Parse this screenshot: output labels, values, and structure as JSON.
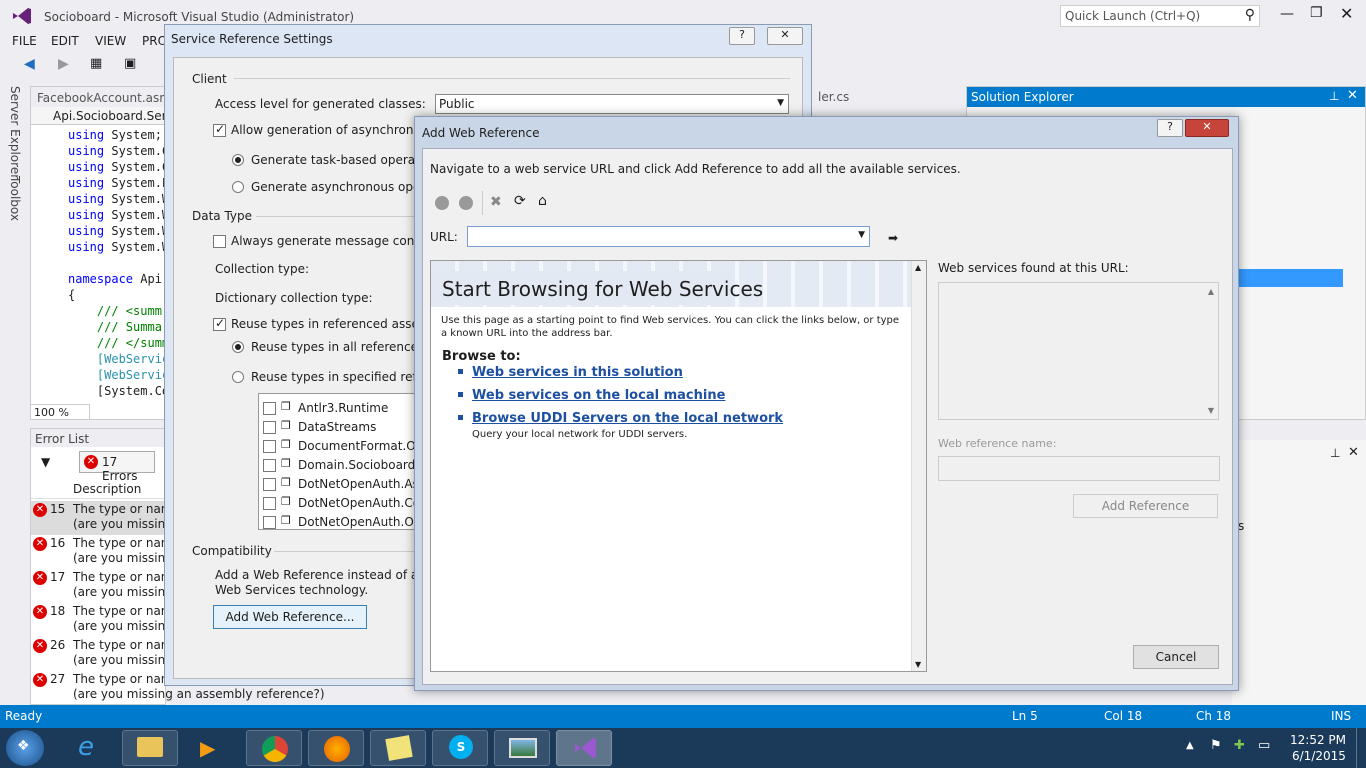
{
  "window": {
    "title": "Socioboard - Microsoft Visual Studio (Administrator)",
    "quick_launch_placeholder": "Quick Launch (Ctrl+Q)"
  },
  "menu": [
    "FILE",
    "EDIT",
    "VIEW",
    "PRO"
  ],
  "side_tabs": [
    "Server Explorer",
    "Toolbox"
  ],
  "editor": {
    "tab": "FacebookAccount.asmx",
    "nav_dropdown": "Api.Socioboard.Servic",
    "zoom": "100 %",
    "lines": [
      {
        "k": "using",
        "t": " System;"
      },
      {
        "k": "using",
        "t": " System.C"
      },
      {
        "k": "using",
        "t": " System.C"
      },
      {
        "k": "using",
        "t": " System.L"
      },
      {
        "k": "using",
        "t": " System.W"
      },
      {
        "k": "using",
        "t": " System.W"
      },
      {
        "k": "using",
        "t": " System.W"
      },
      {
        "k": "using",
        "t": " System.W"
      },
      {
        "k": "",
        "t": ""
      },
      {
        "k": "namespace",
        "t": " Api"
      },
      {
        "k": "",
        "t": "{"
      },
      {
        "k": "",
        "c": "    /// <summ"
      },
      {
        "k": "",
        "c": "    /// Summar"
      },
      {
        "k": "",
        "c": "    /// </summ"
      },
      {
        "k": "",
        "ty": "    [WebServic"
      },
      {
        "k": "",
        "ty": "    [WebServic"
      },
      {
        "k": "",
        "t": "    [System.Co"
      }
    ],
    "second_tab": "ler.cs"
  },
  "error_list": {
    "title": "Error List",
    "errors_button": "17 Errors",
    "column": "Description",
    "rows": [
      {
        "num": "15",
        "l1": "The type or name",
        "l2": "(are you missing"
      },
      {
        "num": "16",
        "l1": "The type or name",
        "l2": "(are you missing"
      },
      {
        "num": "17",
        "l1": "The type or name",
        "l2": "(are you missing"
      },
      {
        "num": "18",
        "l1": "The type or name",
        "l2": "(are you missing"
      },
      {
        "num": "26",
        "l1": "The type or name",
        "l2": "(are you missing"
      },
      {
        "num": "27",
        "l1": "The type or name",
        "l2": "(are you missing an assembly reference?)"
      }
    ]
  },
  "solution_explorer": {
    "title": "Solution Explorer",
    "partial_text": "s"
  },
  "service_ref": {
    "title": "Service Reference Settings",
    "help": "?",
    "client_group": "Client",
    "access_label": "Access level for generated classes:",
    "access_value": "Public",
    "allow_async": "Allow generation of asynchronous",
    "gen_task": "Generate task-based operations",
    "gen_async": "Generate asynchronous operati",
    "data_type_group": "Data Type",
    "always_gen": "Always generate message contracts",
    "collection_type": "Collection type:",
    "dictionary_type": "Dictionary collection type:",
    "reuse_types": "Reuse types in referenced assembli",
    "reuse_all": "Reuse types in all referenced as",
    "reuse_specified": "Reuse types in specified referen",
    "assemblies": [
      "Antlr3.Runtime",
      "DataStreams",
      "DocumentFormat.Ope",
      "Domain.Socioboard",
      "DotNetOpenAuth.Asp",
      "DotNetOpenAuth.Core",
      "DotNetOpenAuth.OAu"
    ],
    "compat_group": "Compatibility",
    "compat_text1": "Add a Web Reference instead of a Serv",
    "compat_text2": "Web Services technology.",
    "add_web_ref_btn": "Add Web Reference..."
  },
  "add_web_ref": {
    "title": "Add Web Reference",
    "help": "?",
    "instruction": "Navigate to a web service URL and click Add Reference to add all the available services.",
    "url_label": "URL:",
    "url_value": "",
    "banner": "Start Browsing for Web Services",
    "intro": "Use this page as a starting point to find Web services. You can click the links below, or type a known URL into the address bar.",
    "browse_to": "Browse to:",
    "links": [
      "Web services in this solution",
      "Web services on the local machine",
      "Browse UDDI Servers on the local network"
    ],
    "uddi_desc": "Query your local network for UDDI servers.",
    "found_label": "Web services found at this URL:",
    "ref_name_label": "Web reference name:",
    "add_ref_btn": "Add Reference",
    "cancel_btn": "Cancel"
  },
  "status": {
    "ready": "Ready",
    "ln": "Ln 5",
    "col": "Col 18",
    "ch": "Ch 18",
    "mode": "INS"
  },
  "clock": {
    "time": "12:52 PM",
    "date": "6/1/2015"
  },
  "colors": {
    "accent": "#007acc",
    "taskbar": "#1b3a5a",
    "link": "#1e50a2",
    "error": "#dd0000"
  }
}
